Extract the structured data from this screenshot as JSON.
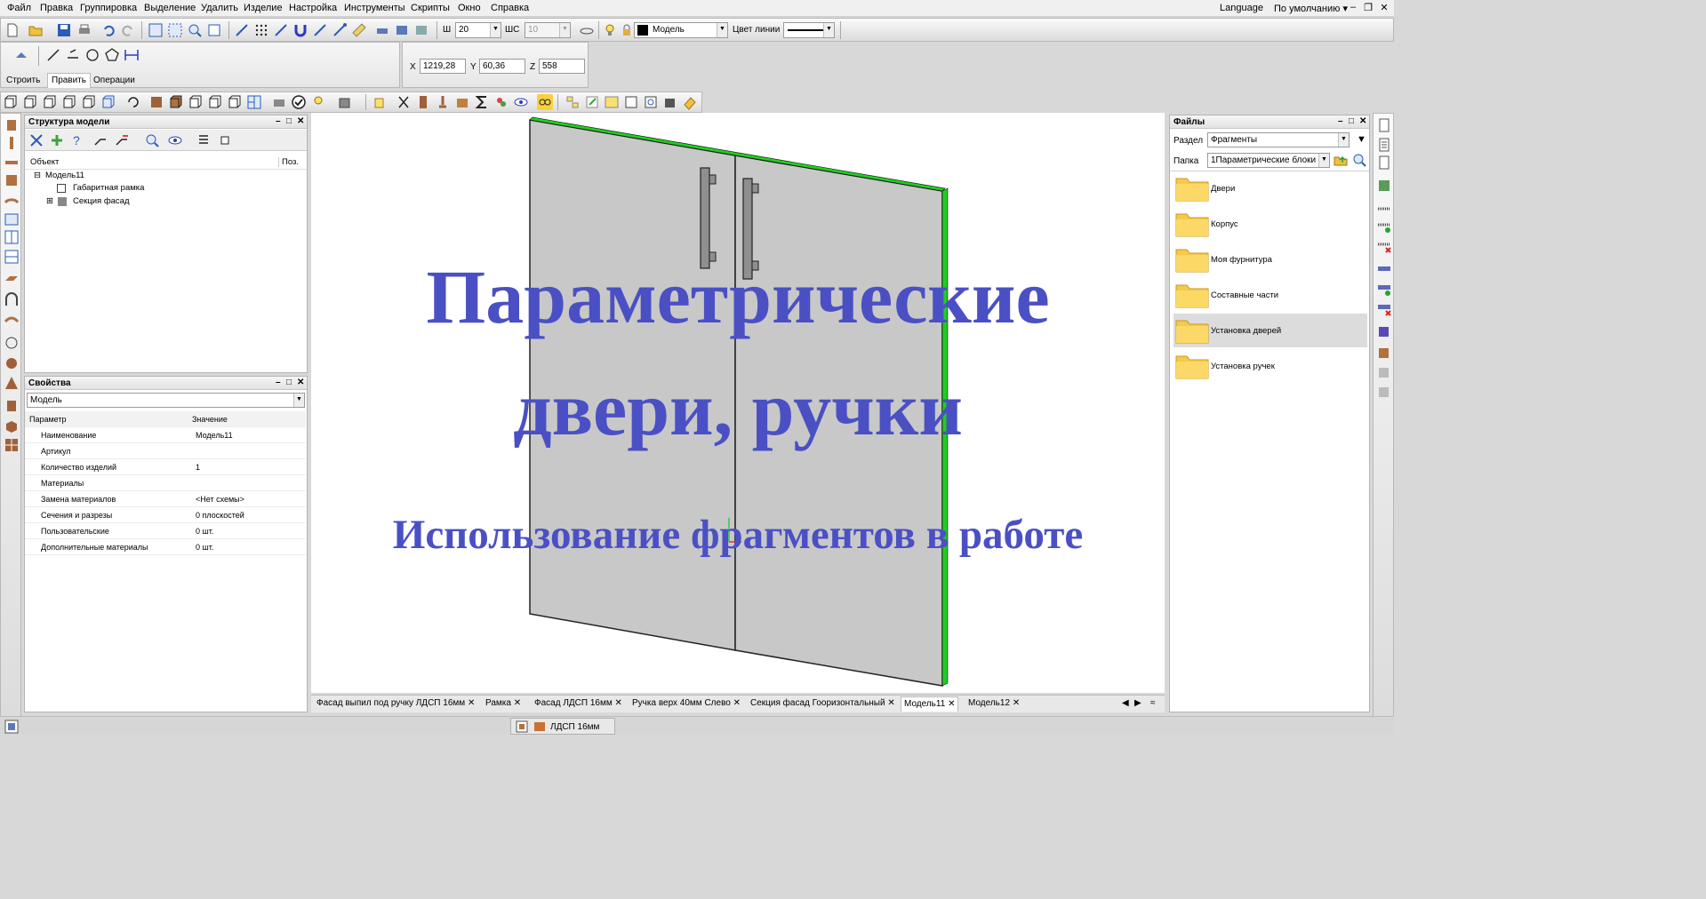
{
  "menu": [
    "Файл",
    "Правка",
    "Группировка",
    "Выделение",
    "Удалить",
    "Изделие",
    "Настройка",
    "Инструменты",
    "Скрипты",
    "Окно",
    "Справка"
  ],
  "language": "Language",
  "preset": "По умолчанию",
  "toolbar": {
    "w_label": "Ш",
    "w_value": "20",
    "ws_label": "ШС",
    "ws_value": "10",
    "layer_value": "Модель",
    "line_color_label": "Цвет линии"
  },
  "coords": {
    "x_label": "X",
    "x": "1219,28",
    "y_label": "Y",
    "y": "60,36",
    "z_label": "Z",
    "z": "558"
  },
  "mode_tabs": [
    "Строить",
    "Править",
    "Операции"
  ],
  "structure": {
    "title": "Структура модели",
    "col_object": "Объект",
    "col_pos": "Поз.",
    "rows": [
      "Модель11",
      "Габаритная рамка",
      "Секция фасад"
    ]
  },
  "properties": {
    "title": "Свойства",
    "selector": "Модель",
    "col_param": "Параметр",
    "col_value": "Значение",
    "rows": [
      {
        "name": "Наименование",
        "value": "Модель11"
      },
      {
        "name": "Артикул",
        "value": ""
      },
      {
        "name": "Количество изделий",
        "value": "1"
      },
      {
        "name": "Материалы",
        "value": ""
      },
      {
        "name": "Замена материалов",
        "value": "<Нет схемы>"
      },
      {
        "name": "Сечения и разрезы",
        "value": "0 плоскостей"
      },
      {
        "name": "Пользовательские",
        "value": "0 шт."
      },
      {
        "name": "Дополнительные материалы",
        "value": "0 шт."
      }
    ]
  },
  "files": {
    "title": "Файлы",
    "section_label": "Раздел",
    "section_value": "Фрагменты",
    "folder_label": "Папка",
    "folder_value": "1Параметрические блоки Ур",
    "items": [
      "Двери",
      "Корпус",
      "Моя фурнитура",
      "Составные части",
      "Установка дверей",
      "Установка ручек"
    ],
    "selected_index": 4
  },
  "overlay": {
    "line1": "Параметрические",
    "line2": "двери, ручки",
    "subtitle": "Использование фрагментов в работе"
  },
  "doc_tabs": [
    "Фасад выпил под ручку ЛДСП 16мм",
    "Рамка",
    "Фасад ЛДСП 16мм",
    "Ручка верх 40мм Слево",
    "Секция фасад Гооризонтальный",
    "Модель11",
    "Модель12"
  ],
  "active_tab": "Модель11",
  "taskbar_item": "ЛДСП 16мм",
  "colors": {
    "overlay_text": "#4a50c4",
    "panel_edge": "#22cc22",
    "door": "#c8c8c8"
  }
}
